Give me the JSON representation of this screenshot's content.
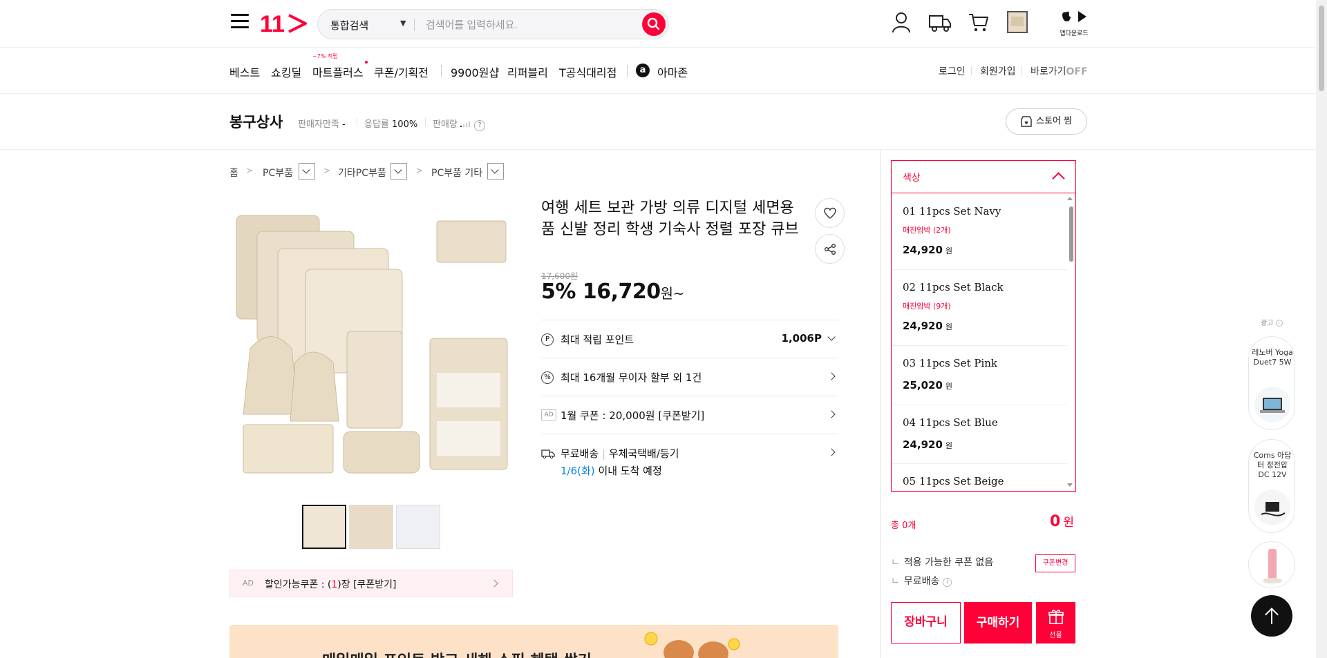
{
  "header": {
    "logo_text": "11",
    "search": {
      "category": "통합검색",
      "placeholder": "검색어를 입력하세요."
    },
    "app_download": "앱다운로드"
  },
  "gnb": {
    "items": [
      "베스트",
      "쇼킹딜",
      "마트플러스",
      "쿠폰/기획전",
      "9900원샵",
      "리퍼블리",
      "T공식대리점",
      "아마존"
    ],
    "mart_badge": "~7% 적립",
    "util": [
      "로그인",
      "회원가입",
      "바로가기",
      "OFF"
    ]
  },
  "store": {
    "name": "봉구상사",
    "satisfaction_label": "판매자만족",
    "satisfaction_value": "-",
    "response_label": "응답률",
    "response_value": "100%",
    "sales_label": "판매량",
    "zzim": "스토어 찜"
  },
  "breadcrumb": [
    "홈",
    "PC부품",
    "기타PC부품",
    "PC부품 기타"
  ],
  "product": {
    "title": "여행 세트 보관 가방 의류 디지털 세면용품 신발 정리 학생 기숙사 정렬 포장 큐브",
    "original_price": "17,600원",
    "discount": "5%",
    "price": "16,720",
    "price_suffix": "원~",
    "rows": {
      "point_label": "최대 적립 포인트",
      "point_value": "1,006P",
      "installment": "최대 16개월 무이자 할부 외 1건",
      "coupon_ad": "AD",
      "coupon": "1월 쿠폰 : 20,000원 [쿠폰받기]",
      "delivery_free": "무료배송",
      "delivery_method": "우체국택배/등기",
      "arrival_date": "1/6(화)",
      "arrival_text": "이내 도착 예정"
    },
    "coupon_banner": {
      "ad": "AD",
      "prefix": "할인가능쿠폰 : (",
      "count": "1",
      "suffix": ")장 [쿠폰받기]"
    },
    "promo_banner": "매일매일 포인트 받고 새해 쇼핑 혜택 쌓기"
  },
  "options": {
    "label": "색상",
    "items": [
      {
        "name": "01 11pcs Set Navy",
        "stock": "매진임박 (2개)",
        "price": "24,920"
      },
      {
        "name": "02 11pcs Set Black",
        "stock": "매진임박 (9개)",
        "price": "24,920"
      },
      {
        "name": "03 11pcs Set Pink",
        "stock": "",
        "price": "25,020"
      },
      {
        "name": "04 11pcs Set Blue",
        "stock": "",
        "price": "24,920"
      },
      {
        "name": "05 11pcs Set Beige",
        "stock": "",
        "price": ""
      }
    ],
    "won": "원"
  },
  "summary": {
    "total_label": "총 0개",
    "total_amount": "0",
    "won": "원",
    "coupon_none": "적용 가능한 쿠폰 없음",
    "coupon_change": "쿠폰변경",
    "free_shipping": "무료배송",
    "cart": "장바구니",
    "buy": "구매하기",
    "gift": "선물"
  },
  "ad_rail": {
    "label": "광고",
    "cards": [
      "레노버 Yoga Duet7 5W",
      "Coms 아답터 정전압 DC 12V"
    ]
  },
  "colors": {
    "brand": "#ff0038",
    "link_blue": "#0b83e6",
    "banner_bg": "#fde2c8"
  }
}
